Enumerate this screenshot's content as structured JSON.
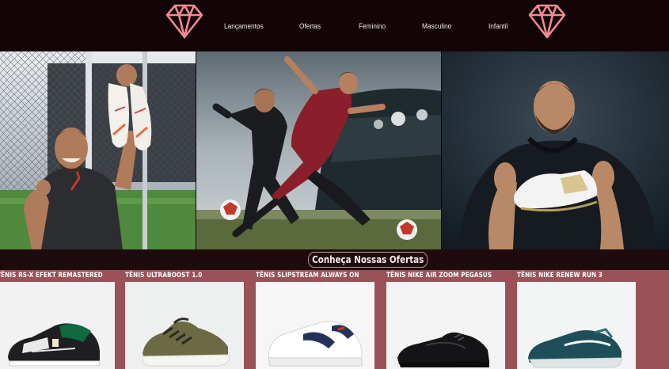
{
  "header": {
    "logo_left": "diamond-icon",
    "logo_right": "diamond-icon",
    "nav": [
      "Lançamentos",
      "Ofertas",
      "Feminino",
      "Masculino",
      "Infantil"
    ]
  },
  "hero": {
    "panels": [
      "player-holding-boots",
      "two-players-kicking-ball",
      "player-holding-boot"
    ]
  },
  "offers": {
    "title": "Conheça Nossas Ofertas"
  },
  "products": [
    {
      "name": "TÊNIS RS-X EFEKT REMASTERED",
      "image": "shoe-image"
    },
    {
      "name": "TÊNIS ULTRABOOST 1.0",
      "image": "shoe-image"
    },
    {
      "name": "TÊNIS SLIPSTREAM ALWAYS ON",
      "image": "shoe-image"
    },
    {
      "name": "TÊNIS NIKE AIR ZOOM PEGASUS",
      "image": "shoe-image"
    },
    {
      "name": "TÊNIS NIKE RENEW RUN 3",
      "image": "shoe-image"
    }
  ],
  "colors": {
    "header_bg": "#120407",
    "accent_pink": "#f08a93",
    "products_bg": "#9a5158",
    "band_bg": "#1e0b0d"
  }
}
